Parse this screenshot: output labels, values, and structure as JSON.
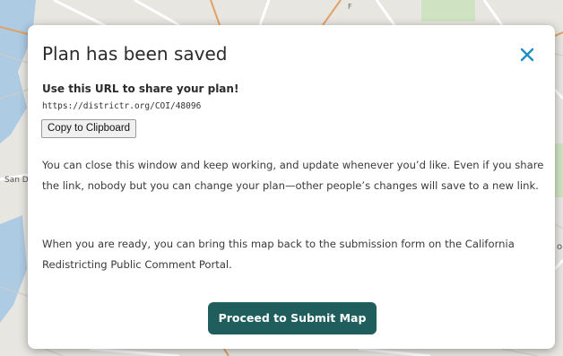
{
  "background": {
    "labels": [
      "San D",
      "F",
      "o"
    ],
    "colors": {
      "land": "#e8e6e1",
      "water": "#aecbe4",
      "road": "#e3a064",
      "street": "#ffffff",
      "park": "#cfe3c3"
    }
  },
  "modal": {
    "title": "Plan has been saved",
    "close_icon": "close-icon",
    "share_heading": "Use this URL to share your plan!",
    "share_url": "https://districtr.org/COI/48096",
    "copy_button": "Copy to Clipboard",
    "paragraph_1": "You can close this window and keep working, and update whenever you’d like. Even if you share the link, nobody but you can change your plan—other people’s changes will save to a new link.",
    "paragraph_2": "When you are ready, you can bring this map back to the submission form on the California Redistricting Public Comment Portal.",
    "submit_button": "Proceed to Submit Map",
    "colors": {
      "accent": "#1f8fbf",
      "button": "#1f5e5d"
    }
  }
}
